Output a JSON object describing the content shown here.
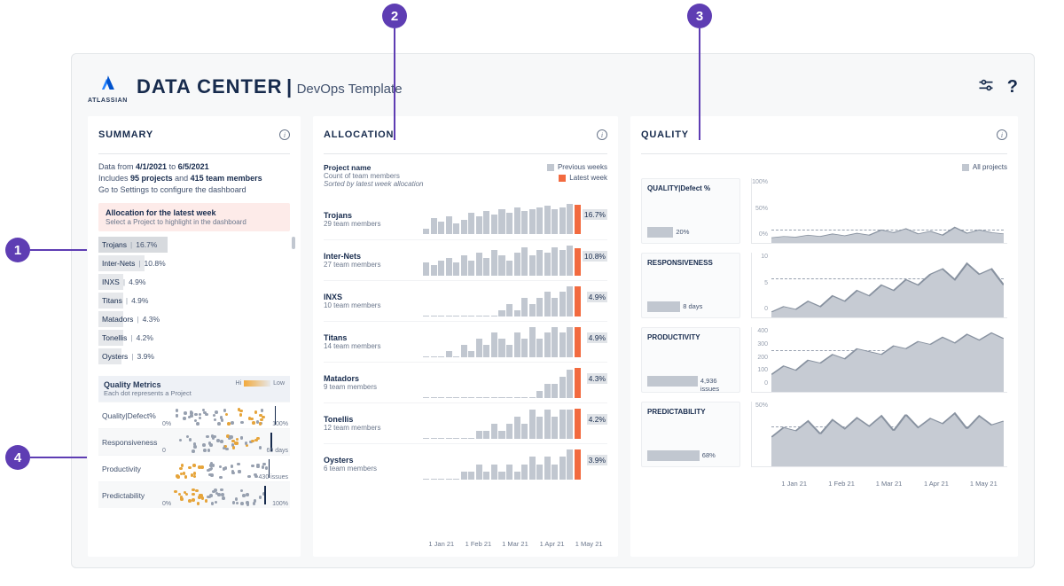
{
  "header": {
    "brand": "ATLASSIAN",
    "title": "DATA CENTER",
    "subtitle": "DevOps Template"
  },
  "callouts": [
    "1",
    "2",
    "3",
    "4"
  ],
  "summary": {
    "title": "SUMMARY",
    "meta": {
      "from_label": "Data from",
      "from": "4/1/2021",
      "to_label": "to",
      "to": "6/5/2021",
      "includes_a": "Includes",
      "projects": "95 projects",
      "and": "and",
      "members": "415 team members",
      "settings": "Go to Settings to configure the dashboard"
    },
    "alloc_banner": {
      "title": "Allocation for the latest week",
      "sub": "Select a Project to highlight in the dashboard"
    },
    "projects": [
      {
        "name": "Trojans",
        "pct": "16.7%",
        "bar": 36
      },
      {
        "name": "Inter-Nets",
        "pct": "10.8%",
        "bar": 24
      },
      {
        "name": "INXS",
        "pct": "4.9%",
        "bar": 13
      },
      {
        "name": "Titans",
        "pct": "4.9%",
        "bar": 13
      },
      {
        "name": "Matadors",
        "pct": "4.3%",
        "bar": 13
      },
      {
        "name": "Tonellis",
        "pct": "4.2%",
        "bar": 13
      },
      {
        "name": "Oysters",
        "pct": "3.9%",
        "bar": 12
      }
    ],
    "quality_metrics": {
      "title": "Quality Metrics",
      "sub": "Each dot represents a Project",
      "hi": "Hi",
      "low": "Low",
      "rows": [
        {
          "name": "Quality|Defect%",
          "lo": "0%",
          "hi": "100%",
          "mark": 88
        },
        {
          "name": "Responsiveness",
          "lo": "0",
          "hi": "69 days",
          "mark": 85
        },
        {
          "name": "Productivity",
          "lo": "",
          "hi": "430 issues",
          "mark": 83
        },
        {
          "name": "Predictability",
          "lo": "0%",
          "hi": "100%",
          "mark": 80
        }
      ]
    }
  },
  "allocation": {
    "title": "ALLOCATION",
    "label": "Project name",
    "sub": "Count of team members",
    "sort": "Sorted by latest week allocation",
    "legend_prev": "Previous weeks",
    "legend_last": "Latest week",
    "axis": [
      "1 Jan 21",
      "1 Feb 21",
      "1 Mar 21",
      "1 Apr 21",
      "1 May 21"
    ],
    "rows": [
      {
        "name": "Trojans",
        "count": "29 team members",
        "pct": "16.7%"
      },
      {
        "name": "Inter-Nets",
        "count": "27 team members",
        "pct": "10.8%"
      },
      {
        "name": "INXS",
        "count": "10 team members",
        "pct": "4.9%"
      },
      {
        "name": "Titans",
        "count": "14 team members",
        "pct": "4.9%"
      },
      {
        "name": "Matadors",
        "count": "9 team members",
        "pct": "4.3%"
      },
      {
        "name": "Tonellis",
        "count": "12 team members",
        "pct": "4.2%"
      },
      {
        "name": "Oysters",
        "count": "6 team members",
        "pct": "3.9%"
      }
    ]
  },
  "quality": {
    "title": "QUALITY",
    "legend": "All projects",
    "axis": [
      "1 Jan 21",
      "1 Feb 21",
      "1 Mar 21",
      "1 Apr 21",
      "1 May 21"
    ],
    "rows": [
      {
        "name": "QUALITY|Defect %",
        "value": "20%",
        "bar": 30,
        "yticks": [
          "100%",
          "50%",
          "0%"
        ]
      },
      {
        "name": "RESPONSIVENESS",
        "value": "8 days",
        "bar": 38,
        "yticks": [
          "10",
          "5",
          "0"
        ]
      },
      {
        "name": "PRODUCTIVITY",
        "value": "4,936 issues",
        "bar": 58,
        "yticks": [
          "400",
          "300",
          "200",
          "100",
          "0"
        ]
      },
      {
        "name": "PREDICTABILITY",
        "value": "68%",
        "bar": 60,
        "yticks": [
          "50%",
          ""
        ]
      }
    ]
  },
  "chart_data": {
    "allocation_sparklines": {
      "type": "bar",
      "note": "approx weekly allocation % per project, last bar = latest week (orange)",
      "series": [
        {
          "name": "Trojans",
          "values": [
            3,
            9,
            7,
            10,
            6,
            8,
            12,
            10,
            13,
            11,
            14,
            12,
            15,
            13,
            14,
            15,
            16,
            14,
            15,
            17,
            16.7
          ]
        },
        {
          "name": "Inter-Nets",
          "values": [
            5,
            4,
            6,
            7,
            5,
            8,
            6,
            9,
            7,
            10,
            8,
            6,
            9,
            11,
            8,
            10,
            9,
            11,
            10,
            12,
            10.8
          ]
        },
        {
          "name": "INXS",
          "values": [
            0,
            0,
            0,
            0,
            0,
            0,
            0,
            0,
            0,
            0,
            1,
            2,
            1,
            3,
            2,
            3,
            4,
            3,
            4,
            5,
            4.9
          ]
        },
        {
          "name": "Titans",
          "values": [
            0,
            0,
            0,
            1,
            0,
            2,
            1,
            3,
            2,
            4,
            3,
            2,
            4,
            3,
            5,
            3,
            4,
            5,
            4,
            5,
            4.9
          ]
        },
        {
          "name": "Matadors",
          "values": [
            0,
            0,
            0,
            0,
            0,
            0,
            0,
            0,
            0,
            0,
            0,
            0,
            0,
            0,
            0,
            1,
            2,
            2,
            3,
            4,
            4.3
          ]
        },
        {
          "name": "Tonellis",
          "values": [
            0,
            0,
            0,
            0,
            0,
            0,
            0,
            1,
            1,
            2,
            1,
            2,
            3,
            2,
            4,
            3,
            4,
            3,
            4,
            4,
            4.2
          ]
        },
        {
          "name": "Oysters",
          "values": [
            0,
            0,
            0,
            0,
            0,
            1,
            1,
            2,
            1,
            2,
            1,
            2,
            1,
            2,
            3,
            2,
            3,
            2,
            3,
            4,
            3.9
          ]
        }
      ]
    },
    "quality_trends": {
      "type": "area",
      "x": [
        "Jan",
        "Feb",
        "Mar",
        "Apr",
        "May"
      ],
      "series": [
        {
          "name": "Quality|Defect %",
          "ylim": [
            0,
            100
          ],
          "values": [
            8,
            10,
            9,
            12,
            10,
            14,
            11,
            15,
            12,
            20,
            16,
            22,
            14,
            18,
            12,
            24,
            15,
            20,
            16,
            14
          ]
        },
        {
          "name": "Responsiveness",
          "ylim": [
            0,
            12
          ],
          "values": [
            1,
            2,
            1.5,
            3,
            2,
            4,
            3,
            5,
            4,
            6,
            5,
            7,
            6,
            8,
            9,
            7,
            10,
            8,
            9,
            6
          ]
        },
        {
          "name": "Productivity",
          "ylim": [
            0,
            450
          ],
          "values": [
            120,
            180,
            150,
            220,
            200,
            260,
            230,
            300,
            280,
            260,
            320,
            300,
            350,
            330,
            380,
            340,
            400,
            360,
            410,
            370
          ]
        },
        {
          "name": "Predictability",
          "ylim": [
            0,
            100
          ],
          "values": [
            45,
            60,
            55,
            70,
            50,
            72,
            58,
            75,
            62,
            78,
            55,
            80,
            60,
            74,
            66,
            82,
            58,
            78,
            64,
            70
          ]
        }
      ]
    }
  }
}
